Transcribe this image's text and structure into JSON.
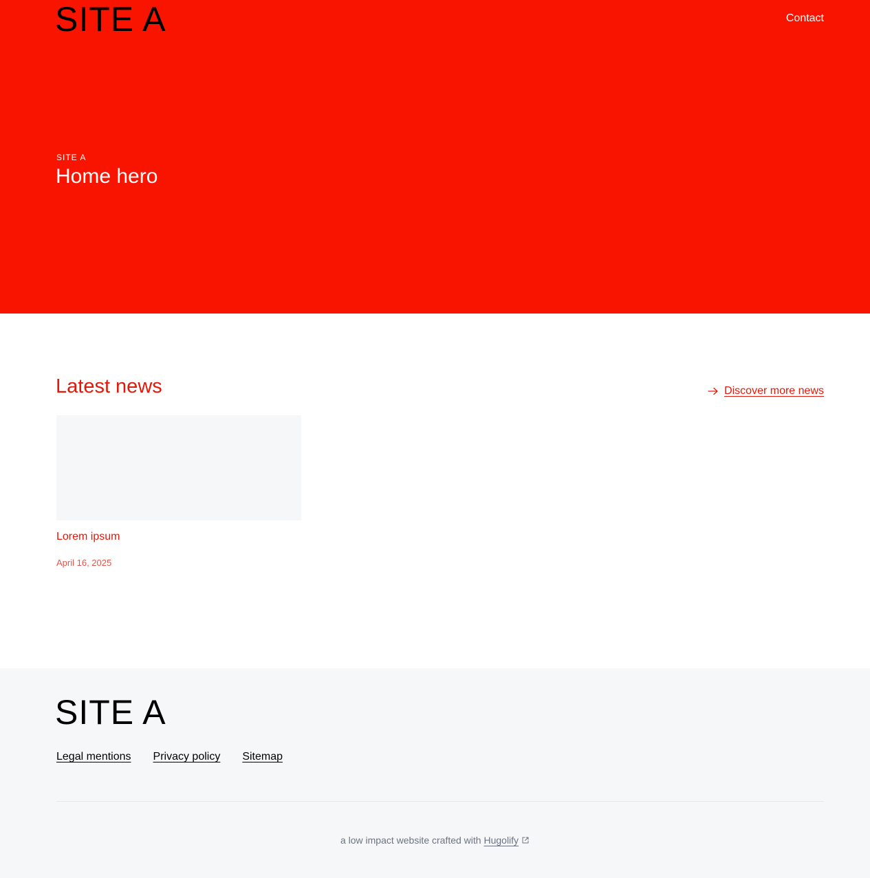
{
  "header": {
    "logo": "SITE A",
    "nav": {
      "contact": "Contact"
    }
  },
  "hero": {
    "kicker": "SITE A",
    "title": "Home hero"
  },
  "news": {
    "title": "Latest news",
    "more_link": "Discover more news",
    "items": [
      {
        "title": "Lorem ipsum",
        "date": "April 16, 2025"
      }
    ]
  },
  "footer": {
    "logo": "SITE A",
    "links": [
      "Legal mentions",
      "Privacy policy",
      "Sitemap"
    ],
    "credit_text": "a low impact website crafted with",
    "credit_link": "Hugolify"
  },
  "colors": {
    "brand_red": "#f91400",
    "accent_red": "#e2190a",
    "footer_bg": "#f6f7f9"
  },
  "icons": {
    "more_link": "arrow-right-icon",
    "credit_link": "external-link-icon"
  }
}
